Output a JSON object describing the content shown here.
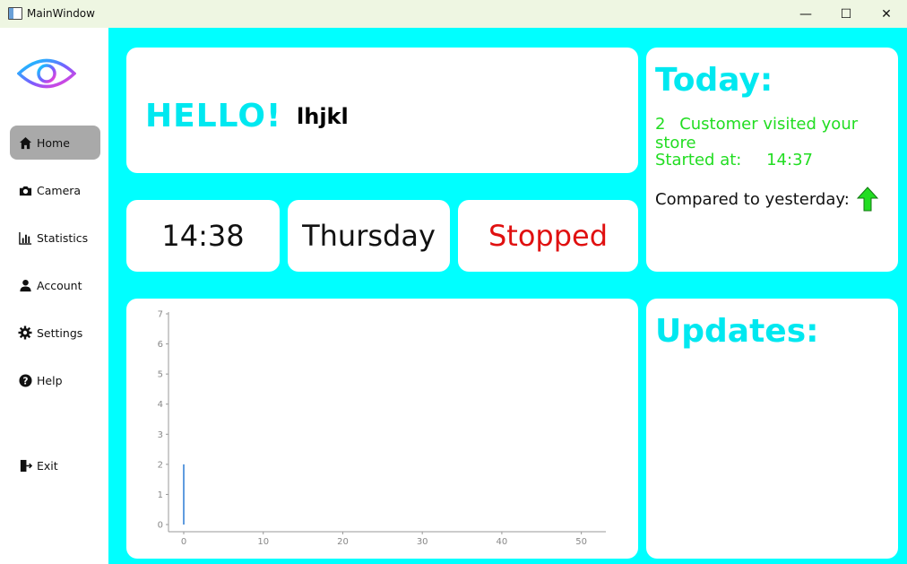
{
  "window": {
    "title": "MainWindow",
    "minimize_glyph": "—",
    "maximize_glyph": "☐",
    "close_glyph": "✕"
  },
  "sidebar": {
    "items": [
      {
        "label": "Home",
        "icon": "home-icon",
        "active": true
      },
      {
        "label": "Camera",
        "icon": "camera-icon",
        "active": false
      },
      {
        "label": "Statistics",
        "icon": "statistics-icon",
        "active": false
      },
      {
        "label": "Account",
        "icon": "account-icon",
        "active": false
      },
      {
        "label": "Settings",
        "icon": "gear-icon",
        "active": false
      },
      {
        "label": "Help",
        "icon": "help-icon",
        "active": false
      },
      {
        "label": "Exit",
        "icon": "exit-icon",
        "active": false
      }
    ]
  },
  "greeting": {
    "hello": "HELLO!",
    "username": "lhjkl"
  },
  "status_cards": {
    "time": "14:38",
    "day": "Thursday",
    "status": "Stopped",
    "status_color": "#e01010"
  },
  "today": {
    "title": "Today:",
    "visits_count": "2",
    "visits_text": "Customer visited your store",
    "started_label": "Started at:",
    "started_time": "14:37",
    "compare_label": "Compared to yesterday:",
    "trend_icon": "up-arrow-icon",
    "trend_color": "#22dd22"
  },
  "updates": {
    "title": "Updates:"
  },
  "colors": {
    "accent_cyan": "#00ffff",
    "title_cyan": "#00e8f0",
    "green_text": "#22dd22",
    "active_nav": "#a9a9a9",
    "series_line": "#2a7bd4"
  },
  "chart_data": {
    "type": "line",
    "x": [
      0,
      0
    ],
    "series": [
      {
        "values": [
          0,
          2
        ]
      }
    ],
    "xlim": [
      0,
      55
    ],
    "ylim": [
      0,
      7
    ],
    "x_ticks": [
      0,
      10,
      20,
      30,
      40,
      50
    ],
    "y_ticks": [
      0,
      1,
      2,
      3,
      4,
      5,
      6,
      7
    ],
    "title": "",
    "xlabel": "",
    "ylabel": "",
    "grid": false
  }
}
